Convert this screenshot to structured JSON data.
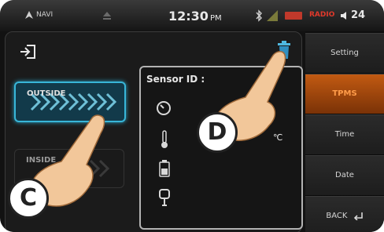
{
  "status_bar": {
    "nav_label": "NAVI",
    "time": "12:30",
    "time_suffix": "PM",
    "radio_label": "RADIO",
    "volume": "24"
  },
  "main": {
    "outside_label": "OUTSIDE",
    "inside_label": "INSIDE"
  },
  "sensor_popup": {
    "title": "Sensor ID :",
    "temp_unit": "℃"
  },
  "sidebar": {
    "items": [
      {
        "label": "Setting"
      },
      {
        "label": "TPMS"
      },
      {
        "label": "Time"
      },
      {
        "label": "Date"
      },
      {
        "label": "BACK"
      }
    ]
  },
  "callouts": {
    "c": "C",
    "d": "D"
  },
  "colors": {
    "accent_orange": "#c25a12",
    "selected_cyan": "#38b6d8",
    "radio_red": "#e0392b"
  },
  "icons": [
    "nav-arrow-icon",
    "eject-icon",
    "bluetooth-icon",
    "signal-icon",
    "battery-icon",
    "volume-icon",
    "exit-icon",
    "trash-icon",
    "gauge-icon",
    "thermometer-icon",
    "battery-level-icon",
    "tire-valve-icon",
    "back-arrow-icon"
  ]
}
